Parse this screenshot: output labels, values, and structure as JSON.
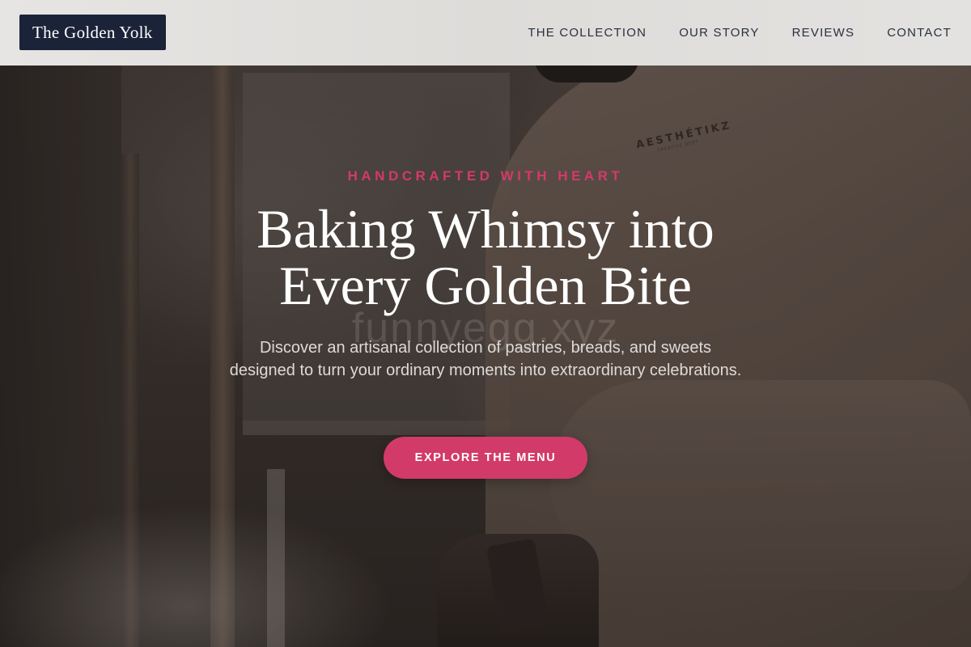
{
  "header": {
    "logo_text": "The Golden Yolk",
    "nav": [
      {
        "label": "THE COLLECTION"
      },
      {
        "label": "OUR STORY"
      },
      {
        "label": "REVIEWS"
      },
      {
        "label": "CONTACT"
      }
    ]
  },
  "hero": {
    "eyebrow": "HANDCRAFTED WITH HEART",
    "headline_line1": "Baking Whimsy into",
    "headline_line2": "Every Golden Bite",
    "watermark": "funnyegg.xyz",
    "subcopy": "Discover an artisanal collection of pastries, breads, and sweets designed to turn your ordinary moments into extraordinary celebrations.",
    "cta_label": "EXPLORE THE MENU",
    "shirt_print": "AESTHÉTIKZ",
    "shirt_print_sub": "CREATIVE DEPT"
  },
  "colors": {
    "accent": "#d23a6a",
    "logo_bg": "#1b2339",
    "header_bg": "#e3e2e0",
    "nav_text": "#2a3040"
  }
}
